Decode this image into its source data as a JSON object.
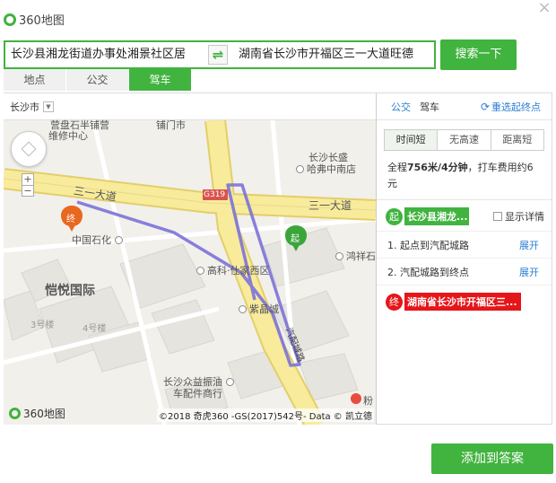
{
  "header": {
    "logo_text": "360地图",
    "close_symbol": "×"
  },
  "search": {
    "from_value": "长沙县湘龙街道办事处湘景社区居",
    "swap_symbol": "⇌",
    "to_value": "湖南省长沙市开福区三一大道旺德",
    "button_label": "搜索一下"
  },
  "modes": [
    {
      "label": "地点",
      "active": false
    },
    {
      "label": "公交",
      "active": false
    },
    {
      "label": "驾车",
      "active": true
    }
  ],
  "map": {
    "city": "长沙市",
    "zoom_in": "+",
    "zoom_out": "−",
    "footer_logo": "360地图",
    "copyright": "©2018 奇虎360 -GS(2017)542号- Data © 凯立德",
    "labels": {
      "top_poi": "营盘石半铺营",
      "repair": "维修中心",
      "shop_top": "铺门市",
      "hotel_a": "长沙长盛",
      "hotel_b": "哈弗中南店",
      "road_sanyi_left": "三一大道",
      "road_sanyi_right": "三一大道",
      "g319": "G319",
      "sinopec": "中国石化",
      "gaoke": "高科·仕家西区",
      "hongxiang": "鸿祥石",
      "kaiyue": "恺悦国际",
      "building3": "3号楼",
      "building4": "4号楼",
      "ziji": "紫晶城",
      "qiche_road": "汽配城路",
      "auto_parts_a": "长沙众益振油",
      "auto_parts_b": "车配件商行",
      "fen": "粉",
      "end_marker": "终",
      "start_marker": "起"
    }
  },
  "panel": {
    "tab_bus": "公交",
    "tab_car": "驾车",
    "reselect_label": "重选起终点",
    "prefs": [
      {
        "label": "时间短",
        "active": true
      },
      {
        "label": "无高速",
        "active": false
      },
      {
        "label": "距离短",
        "active": false
      }
    ],
    "summary_prefix": "全程",
    "summary_distance": "756米/4分钟",
    "summary_suffix": "，打车费用约6元",
    "start_badge": "起",
    "start_name": "长沙县湘龙...",
    "show_detail_label": "显示详情",
    "steps": [
      {
        "text": "1. 起点到汽配城路",
        "action": "展开"
      },
      {
        "text": "2. 汽配城路到终点",
        "action": "展开"
      }
    ],
    "end_badge": "终",
    "end_name": "湖南省长沙市开福区三..."
  },
  "footer": {
    "add_button": "添加到答案"
  },
  "colors": {
    "brand_green": "#41b33f",
    "link_blue": "#2b7fd1",
    "end_red": "#e5161a",
    "route_purple": "#7b72d8",
    "road_yellow": "#f6e58a"
  }
}
